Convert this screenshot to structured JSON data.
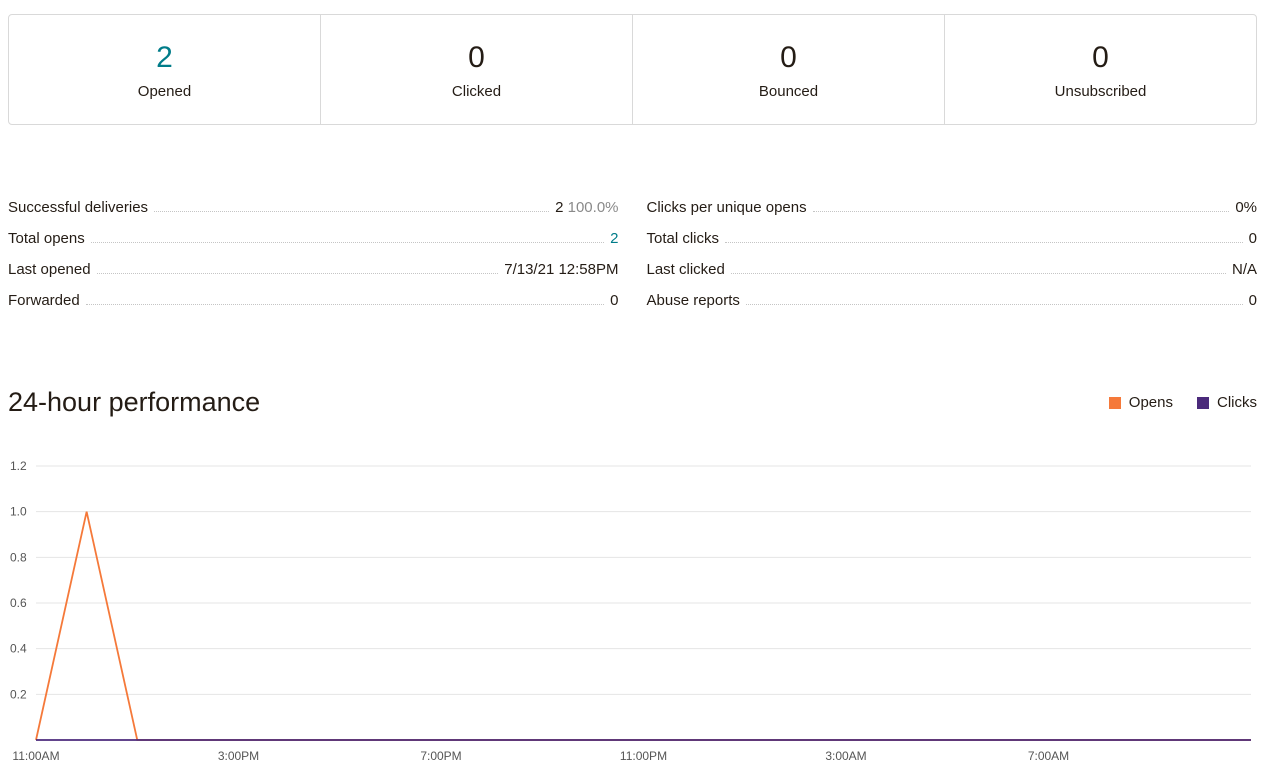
{
  "stats": [
    {
      "value": "2",
      "label": "Opened",
      "highlight": true
    },
    {
      "value": "0",
      "label": "Clicked",
      "highlight": false
    },
    {
      "value": "0",
      "label": "Bounced",
      "highlight": false
    },
    {
      "value": "0",
      "label": "Unsubscribed",
      "highlight": false
    }
  ],
  "metrics_left": [
    {
      "label": "Successful deliveries",
      "value": "2",
      "suffix": "100.0%",
      "link": false
    },
    {
      "label": "Total opens",
      "value": "2",
      "suffix": "",
      "link": true
    },
    {
      "label": "Last opened",
      "value": "7/13/21 12:58PM",
      "suffix": "",
      "link": false
    },
    {
      "label": "Forwarded",
      "value": "0",
      "suffix": "",
      "link": false
    }
  ],
  "metrics_right": [
    {
      "label": "Clicks per unique opens",
      "value": "0%",
      "suffix": "",
      "link": false
    },
    {
      "label": "Total clicks",
      "value": "0",
      "suffix": "",
      "link": false
    },
    {
      "label": "Last clicked",
      "value": "N/A",
      "suffix": "",
      "link": false
    },
    {
      "label": "Abuse reports",
      "value": "0",
      "suffix": "",
      "link": false
    }
  ],
  "performance": {
    "title": "24-hour performance",
    "legend": {
      "opens": "Opens",
      "clicks": "Clicks"
    }
  },
  "chart_data": {
    "type": "line",
    "title": "24-hour performance",
    "xlabel": "",
    "ylabel": "",
    "ylim": [
      0,
      1.2
    ],
    "y_ticks": [
      0,
      0.2,
      0.4,
      0.6,
      0.8,
      1.0,
      1.2
    ],
    "x_tick_labels": [
      "11:00AM",
      "3:00PM",
      "7:00PM",
      "11:00PM",
      "3:00AM",
      "7:00AM"
    ],
    "x_tick_positions": [
      0,
      4,
      8,
      12,
      16,
      20
    ],
    "x_count": 25,
    "series": [
      {
        "name": "Opens",
        "color": "#f5793a",
        "values": [
          0,
          1,
          0,
          0,
          0,
          0,
          0,
          0,
          0,
          0,
          0,
          0,
          0,
          0,
          0,
          0,
          0,
          0,
          0,
          0,
          0,
          0,
          0,
          0,
          0
        ]
      },
      {
        "name": "Clicks",
        "color": "#4b2a7b",
        "values": [
          0,
          0,
          0,
          0,
          0,
          0,
          0,
          0,
          0,
          0,
          0,
          0,
          0,
          0,
          0,
          0,
          0,
          0,
          0,
          0,
          0,
          0,
          0,
          0,
          0
        ]
      }
    ]
  }
}
